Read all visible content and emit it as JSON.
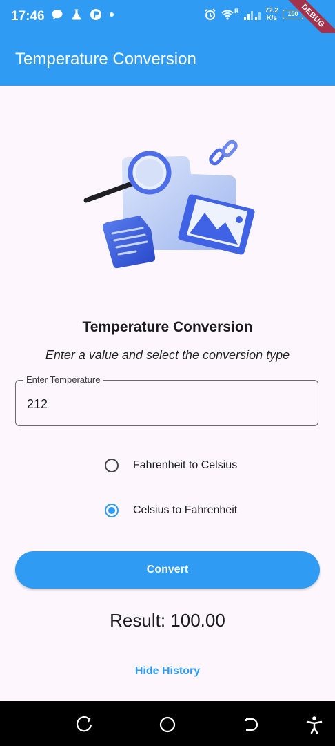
{
  "status_bar": {
    "time": "17:46",
    "net_speed_value": "72.2",
    "net_speed_unit": "K/s",
    "signal_label": "R",
    "battery": "100"
  },
  "debug_banner": "DEBUG",
  "app_bar": {
    "title": "Temperature Conversion"
  },
  "main": {
    "heading": "Temperature Conversion",
    "subheading": "Enter a value and select the conversion type",
    "input": {
      "label": "Enter Temperature",
      "value": "212"
    },
    "options": [
      {
        "label": "Fahrenheit to Celsius",
        "selected": false
      },
      {
        "label": "Celsius to Fahrenheit",
        "selected": true
      }
    ],
    "convert_label": "Convert",
    "result": "Result: 100.00",
    "history_toggle": "Hide History"
  },
  "colors": {
    "primary": "#2f9bf3",
    "background": "#fdf7fd",
    "ribbon": "#a3334c"
  },
  "icons": [
    "message-icon",
    "flask-icon",
    "app-icon",
    "alarm-icon",
    "wifi-icon",
    "signal-icon",
    "battery-icon",
    "recents-icon",
    "home-icon",
    "back-icon",
    "accessibility-icon"
  ]
}
